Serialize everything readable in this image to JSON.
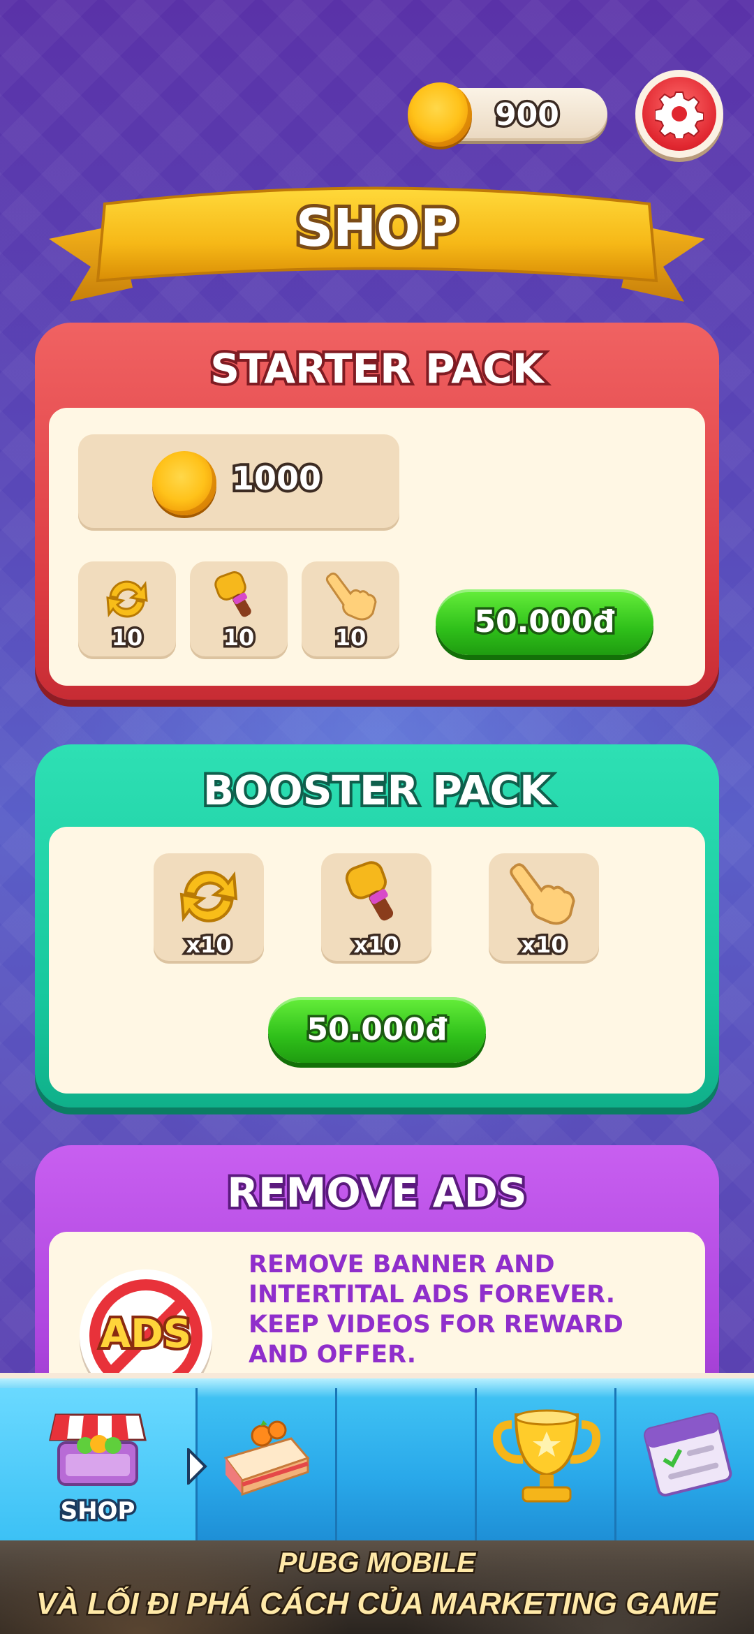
{
  "header": {
    "coin_balance": "900",
    "settings_icon": "gear-icon"
  },
  "banner": {
    "title": "SHOP"
  },
  "starter_pack": {
    "title": "STARTER PACK",
    "coins": "1000",
    "items": [
      {
        "icon": "refresh-icon",
        "count": "10"
      },
      {
        "icon": "hammer-icon",
        "count": "10"
      },
      {
        "icon": "pointing-hand-icon",
        "count": "10"
      }
    ],
    "price": "50.000đ"
  },
  "booster_pack": {
    "title": "BOOSTER PACK",
    "items": [
      {
        "icon": "refresh-icon",
        "count": "x10"
      },
      {
        "icon": "hammer-icon",
        "count": "x10"
      },
      {
        "icon": "pointing-hand-icon",
        "count": "x10"
      }
    ],
    "price": "50.000đ"
  },
  "remove_ads": {
    "title": "REMOVE ADS",
    "badge": "ADS",
    "description": "REMOVE BANNER AND INTERTITAL ADS FOREVER. KEEP VIDEOS FOR REWARD AND OFFER."
  },
  "nav": {
    "shop_label": "SHOP",
    "tabs": [
      "shop-icon",
      "cake-icon",
      "empty",
      "trophy-icon",
      "calendar-icon"
    ]
  },
  "ad_banner": {
    "line1": "PUBG MOBILE",
    "line2": "VÀ LỐI ĐI PHÁ CÁCH CỦA MARKETING GAME"
  },
  "colors": {
    "starter": "#dd3c42",
    "booster": "#17c79d",
    "remove_ads": "#ad45de",
    "price_button": "#2fc01a",
    "background": "#5a48b6"
  }
}
